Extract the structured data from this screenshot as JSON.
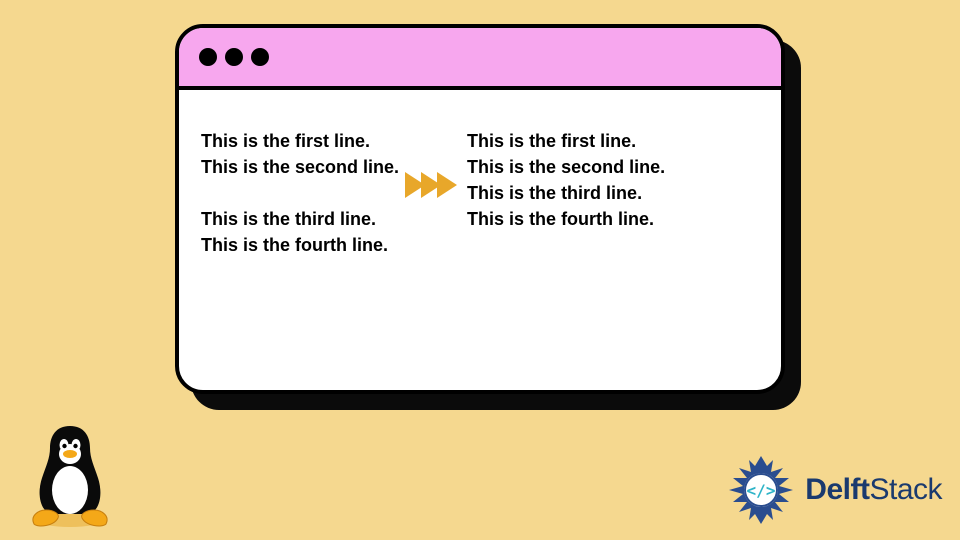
{
  "window": {
    "left": {
      "lines": [
        "This is the first line.",
        "This is the second line.",
        "",
        "This is the third line.",
        "This is the fourth line."
      ]
    },
    "right": {
      "lines": [
        "This is the first line.",
        "This is the second line.",
        "This is the third line.",
        "This is the fourth line."
      ]
    }
  },
  "brand": {
    "name_bold": "Delft",
    "name_rest": "Stack"
  },
  "icons": {
    "penguin": "tux-penguin",
    "brand_logo": "delftstack-logo",
    "arrow": "chevron-right"
  },
  "colors": {
    "bg": "#f5d88f",
    "titlebar": "#f7a7ee",
    "arrow": "#e8a72a",
    "brand": "#1a3a6e"
  }
}
